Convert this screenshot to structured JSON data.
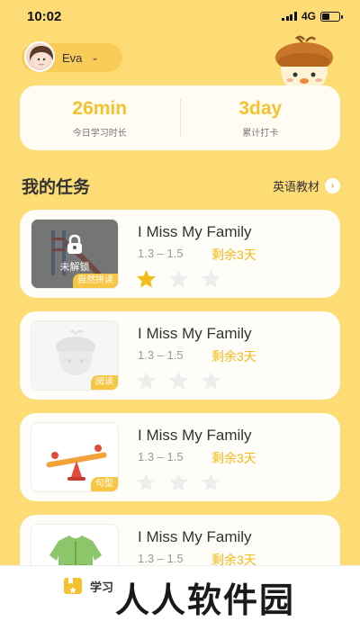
{
  "status_bar": {
    "time": "10:02",
    "network": "4G"
  },
  "profile": {
    "name": "Eva",
    "dropdown_icon": "chevron-down-icon"
  },
  "stats": [
    {
      "value": "26min",
      "label": "今日学习时长"
    },
    {
      "value": "3day",
      "label": "累计打卡"
    }
  ],
  "section": {
    "title": "我的任务",
    "textbook_link": "英语教材",
    "textbook_icon": "chevron-right-icon"
  },
  "tasks": [
    {
      "title": "I Miss My Family",
      "range": "1.3 – 1.5",
      "remaining": "剩余3天",
      "tag": "自然拼读",
      "locked_text": "未解锁",
      "stars_earned": 1,
      "stars_total": 3,
      "image": "slide-icon"
    },
    {
      "title": "I Miss My Family",
      "range": "1.3 – 1.5",
      "remaining": "剩余3天",
      "tag": "阅读",
      "stars_earned": 0,
      "stars_total": 3,
      "image": "mascot-placeholder-icon"
    },
    {
      "title": "I Miss My Family",
      "range": "1.3 – 1.5",
      "remaining": "剩余3天",
      "tag": "句型",
      "stars_earned": 0,
      "stars_total": 3,
      "image": "seesaw-icon"
    },
    {
      "title": "I Miss My Family",
      "range": "1.3 – 1.5",
      "remaining": "剩余3天",
      "stars_earned": 0,
      "stars_total": 3,
      "image": "jacket-icon"
    }
  ],
  "bottom_nav": {
    "study_label": "学习",
    "study_icon": "book-icon"
  },
  "watermark": "人人软件园",
  "colors": {
    "background": "#FDDC76",
    "accent": "#F5C22D",
    "tag": "#F7C744",
    "star_filled": "#F5BD1A",
    "star_empty": "#EDEDED"
  }
}
